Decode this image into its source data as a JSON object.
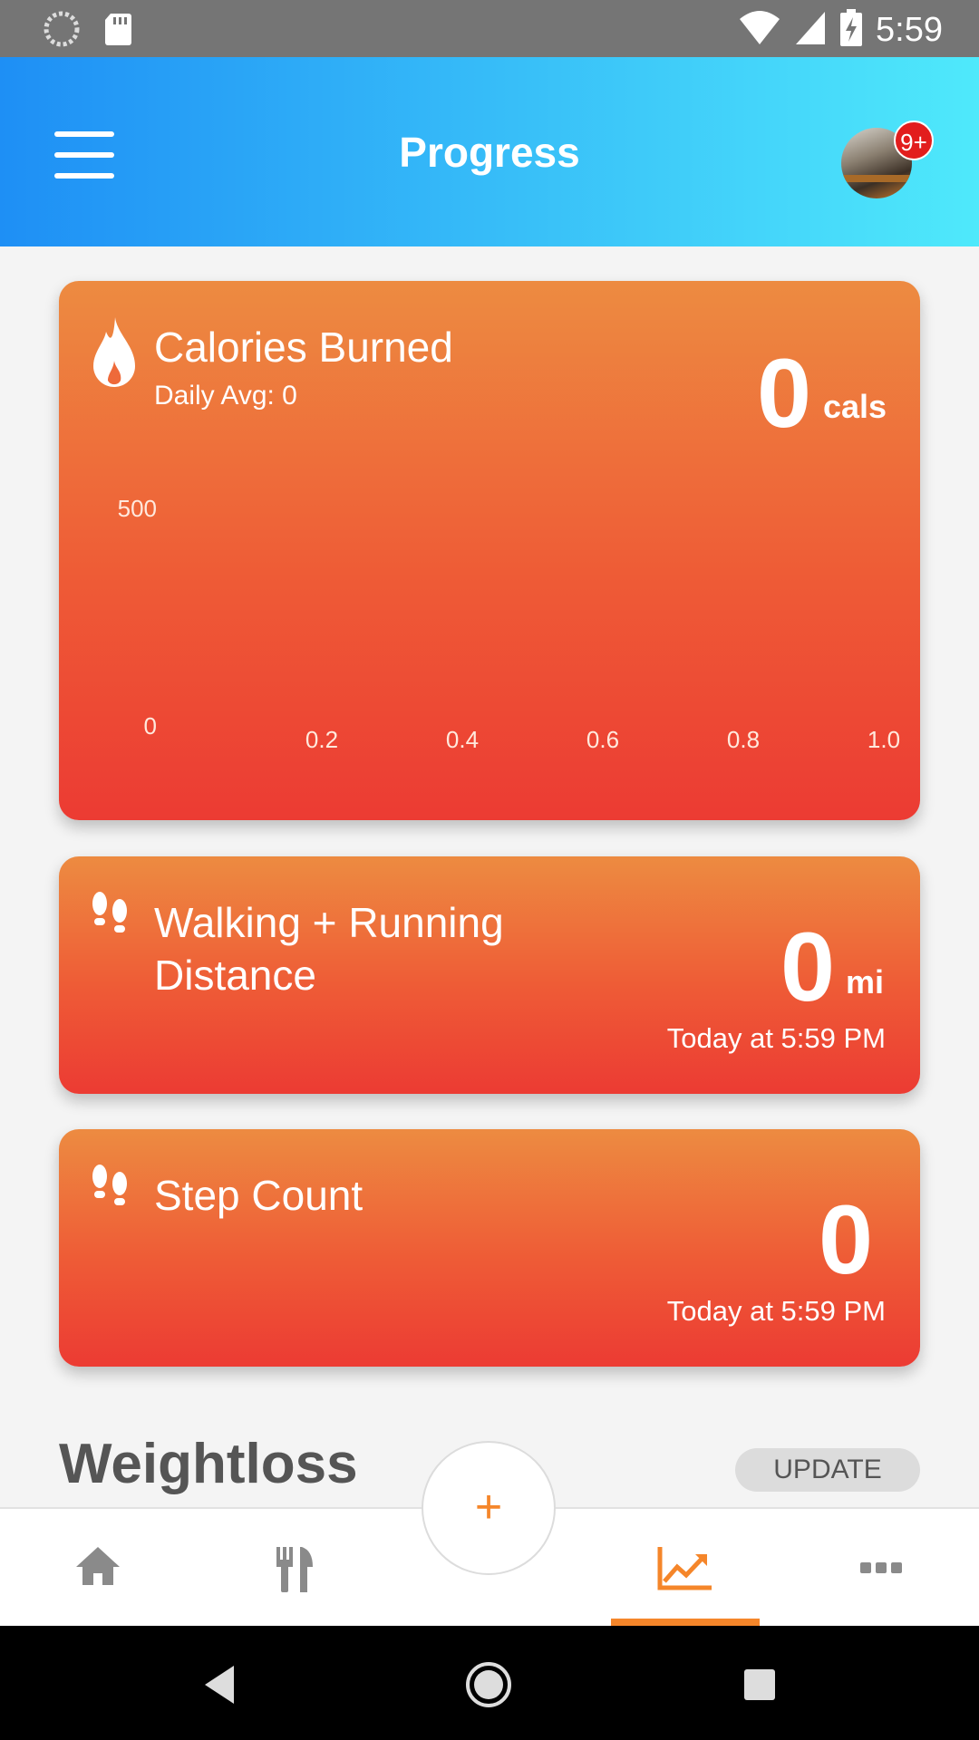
{
  "status_bar": {
    "time": "5:59"
  },
  "header": {
    "title": "Progress",
    "notification_badge": "9+"
  },
  "cards": {
    "calories": {
      "title": "Calories Burned",
      "daily_avg": "Daily Avg: 0",
      "value": "0",
      "unit": "cals"
    },
    "distance": {
      "title_line1": "Walking + Running",
      "title_line2": "Distance",
      "value": "0",
      "unit": "mi",
      "timestamp": "Today at 5:59 PM"
    },
    "steps": {
      "title": "Step Count",
      "value": "0",
      "timestamp": "Today at 5:59 PM"
    }
  },
  "chart_data": {
    "type": "line",
    "x": [],
    "series": [],
    "ylim": [
      0,
      500
    ],
    "xlim": [
      0,
      1.0
    ],
    "y_ticks": [
      "0",
      "500"
    ],
    "x_ticks": [
      "0.2",
      "0.4",
      "0.6",
      "0.8",
      "1.0"
    ],
    "grid": false
  },
  "weightloss": {
    "title": "Weightloss",
    "update_label": "UPDATE"
  },
  "fab": {
    "label": "+"
  },
  "bottom_nav": {
    "items": [
      "home-icon",
      "food-icon",
      "add",
      "progress-icon",
      "more-icon"
    ],
    "active": "progress-icon",
    "active_color": "#f5862a",
    "inactive_color": "#8a8a8a"
  },
  "colors": {
    "header_gradient_start": "#1e8ff5",
    "header_gradient_end": "#4fe9fb",
    "card_gradient_top": "#ed8b41",
    "card_gradient_bottom": "#ec3b33"
  }
}
